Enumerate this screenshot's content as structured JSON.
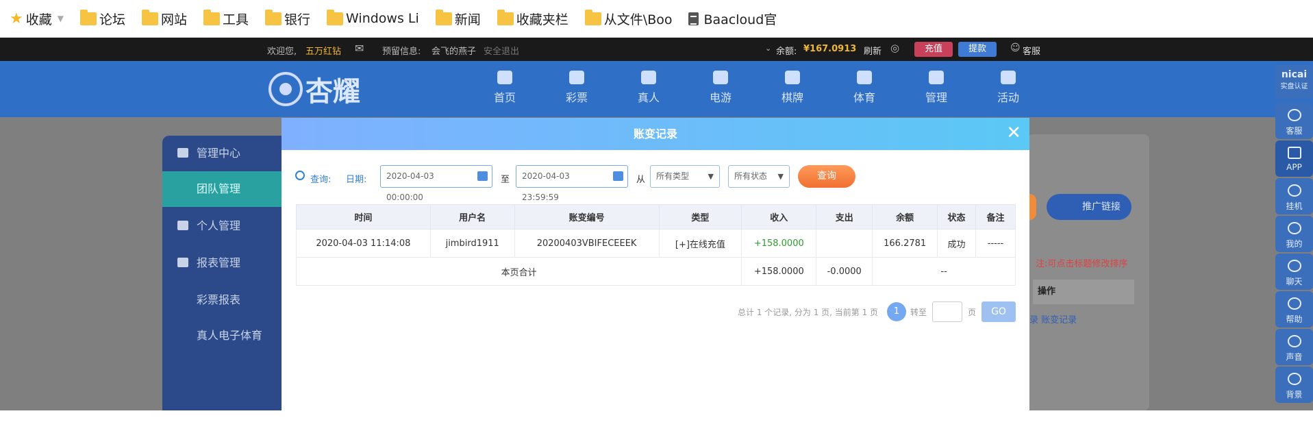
{
  "bookmarks": {
    "items": [
      {
        "label": "收藏",
        "type": "star"
      },
      {
        "label": "论坛",
        "type": "folder"
      },
      {
        "label": "网站",
        "type": "folder"
      },
      {
        "label": "工具",
        "type": "folder"
      },
      {
        "label": "银行",
        "type": "folder"
      },
      {
        "label": "Windows Li",
        "type": "folder"
      },
      {
        "label": "新闻",
        "type": "folder"
      },
      {
        "label": "收藏夹栏",
        "type": "folder"
      },
      {
        "label": "从文件\\Boo",
        "type": "folder"
      },
      {
        "label": "Baacloud官",
        "type": "doc"
      }
    ]
  },
  "topbar": {
    "welcome": "欢迎您,",
    "user": "五万红钻",
    "reserved_label": "预留信息:",
    "reserved_value": "会飞的燕子",
    "logout": "安全退出",
    "balance_label": "余额:",
    "balance_value": "¥167.0913",
    "refresh": "刷新",
    "deposit": "充值",
    "withdraw": "提款",
    "service": "客服"
  },
  "header": {
    "logo": "杏耀",
    "nav": [
      "首页",
      "彩票",
      "真人",
      "电游",
      "棋牌",
      "体育",
      "管理",
      "活动"
    ]
  },
  "sidebar": {
    "items": [
      {
        "label": "管理中心",
        "icon": "users-icon"
      },
      {
        "label": "团队管理",
        "icon": ""
      },
      {
        "label": "个人管理",
        "icon": "user-icon"
      },
      {
        "label": "报表管理",
        "icon": "report-icon"
      },
      {
        "label": "彩票报表",
        "icon": ""
      },
      {
        "label": "真人电子体育",
        "icon": ""
      }
    ]
  },
  "right_tools": {
    "top_label": "nicai",
    "top_sub": "实盘认证",
    "items": [
      "客服",
      "APP",
      "挂机",
      "我的",
      "聊天",
      "帮助",
      "声音",
      "背景"
    ]
  },
  "background": {
    "promo": "推广链接",
    "note": "注:可点击标题修改排序",
    "op_header": "操作",
    "links": "录  账变记录"
  },
  "modal": {
    "title": "账变记录",
    "close": "✕",
    "query_label": "查询:",
    "date_label": "日期:",
    "date_from": "2020-04-03 00:00:00",
    "to_label": "至",
    "date_to": "2020-04-03 23:59:59",
    "from_label": "从",
    "type_select": "所有类型",
    "status_select": "所有状态",
    "query_button": "查询",
    "columns": [
      "时间",
      "用户名",
      "账变编号",
      "类型",
      "收入",
      "支出",
      "余额",
      "状态",
      "备注"
    ],
    "rows": [
      {
        "time": "2020-04-03 11:14:08",
        "user": "jimbird1911",
        "id": "20200403VBIFECEEEK",
        "type": "[+]在线充值",
        "income": "+158.0000",
        "expense": "",
        "balance": "166.2781",
        "status": "成功",
        "remark": "-----"
      }
    ],
    "summary": {
      "label": "本页合计",
      "income": "+158.0000",
      "expense": "-0.0000",
      "rest": "--"
    },
    "pager": {
      "summary": "总计 1 个记录, 分为 1 页, 当前第 1 页",
      "current": "1",
      "goto": "转至",
      "page_unit": "页",
      "go": "GO"
    }
  }
}
